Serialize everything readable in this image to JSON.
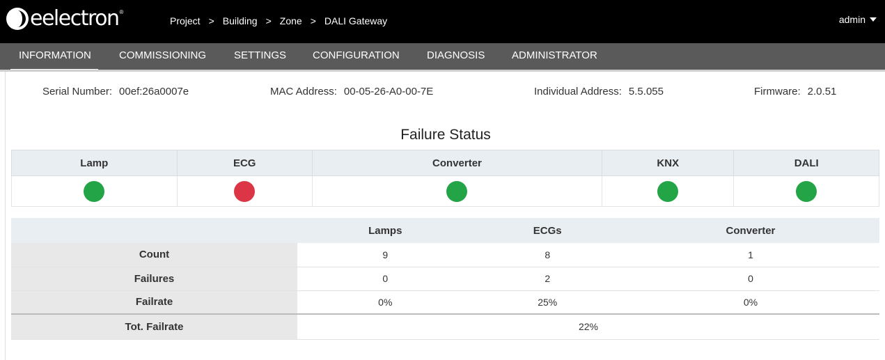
{
  "brand": {
    "name": "eelectron",
    "reg": "®"
  },
  "breadcrumb": [
    "Project",
    "Building",
    "Zone",
    "DALI Gateway"
  ],
  "breadcrumb_sep": ">",
  "user": {
    "name": "admin"
  },
  "nav": [
    "INFORMATION",
    "COMMISSIONING",
    "SETTINGS",
    "CONFIGURATION",
    "DIAGNOSIS",
    "ADMINISTRATOR"
  ],
  "nav_active": "INFORMATION",
  "device": {
    "serial_label": "Serial Number:",
    "serial_value": "00ef:26a0007e",
    "mac_label": "MAC Address:",
    "mac_value": "00-05-26-A0-00-7E",
    "ia_label": "Individual Address:",
    "ia_value": "5.5.055",
    "fw_label": "Firmware:",
    "fw_value": "2.0.51"
  },
  "failure_status": {
    "title": "Failure Status",
    "columns": [
      {
        "name": "Lamp",
        "status": "ok"
      },
      {
        "name": "ECG",
        "status": "failure"
      },
      {
        "name": "Converter",
        "status": "ok"
      },
      {
        "name": "KNX",
        "status": "ok"
      },
      {
        "name": "DALI",
        "status": "ok"
      }
    ],
    "colors": {
      "ok": "#22a447",
      "failure": "#dc3545"
    }
  },
  "stats": {
    "headers": [
      "",
      "Lamps",
      "ECGs",
      "Converter"
    ],
    "rows": [
      {
        "label": "Count",
        "values": [
          "9",
          "8",
          "1"
        ]
      },
      {
        "label": "Failures",
        "values": [
          "0",
          "2",
          "0"
        ]
      },
      {
        "label": "Failrate",
        "values": [
          "0%",
          "25%",
          "0%"
        ]
      }
    ],
    "total": {
      "label": "Tot. Failrate",
      "value": "22%"
    }
  }
}
